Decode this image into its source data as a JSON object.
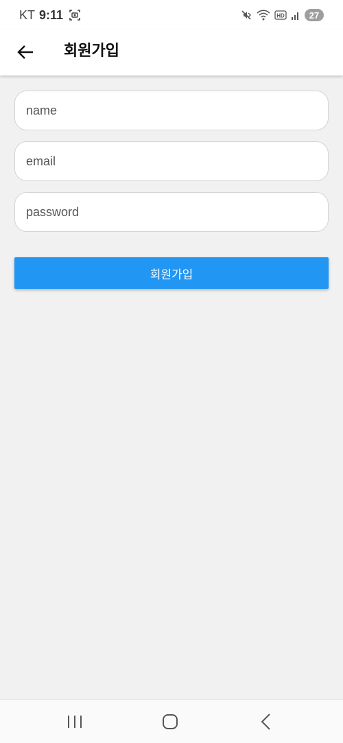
{
  "status_bar": {
    "carrier": "KT",
    "time": "9:11",
    "battery": "27",
    "icons": [
      "screenshot-icon",
      "mute-icon",
      "wifi-icon",
      "hd-icon",
      "signal-icon"
    ]
  },
  "app_bar": {
    "title": "회원가입",
    "back_icon": "arrow-left-icon"
  },
  "form": {
    "name_placeholder": "name",
    "email_placeholder": "email",
    "password_placeholder": "password",
    "name_value": "",
    "email_value": "",
    "password_value": "",
    "submit_label": "회원가입"
  },
  "nav_bar": {
    "icons": [
      "recent-apps-icon",
      "home-icon",
      "back-icon"
    ]
  },
  "colors": {
    "accent": "#2196f3",
    "background": "#f1f1f1"
  }
}
